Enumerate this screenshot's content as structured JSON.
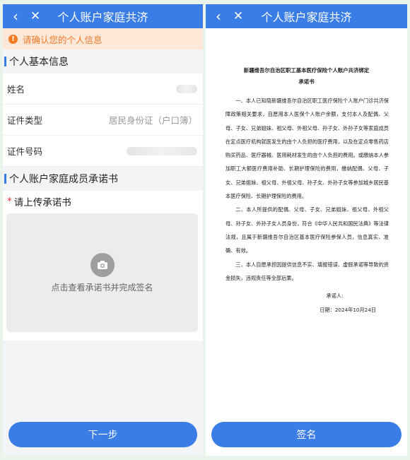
{
  "left": {
    "title": "个人账户家庭共济",
    "back_icon": "chevron-left-icon",
    "close_icon": "close-icon",
    "notice": "请确认您的个人信息",
    "basic_section": "个人基本信息",
    "rows": [
      {
        "label": "姓名",
        "value": ""
      },
      {
        "label": "证件类型",
        "value": "居民身份证（户口簿）"
      },
      {
        "label": "证件号码",
        "value": ""
      }
    ],
    "pledge_section": "个人账户家庭成员承诺书",
    "upload_required": "*",
    "upload_label": "请上传承诺书",
    "upload_hint": "点击查看承诺书并完成签名",
    "next_button": "下一步"
  },
  "right": {
    "title": "个人账户家庭共济",
    "doc_title": "新疆维吾尔自治区职工基本医疗保险个人账户共济绑定",
    "doc_sub": "承诺书",
    "paragraphs": [
      "一、本人已知晓新疆维吾尔自治区职工医疗保险个人账户门诊共济保障政策相关要求，自愿用本人医保个人账户余额，支付本人及配偶、父母、子女、兄弟姐妹、祖父母、外祖父母、孙子女、外孙子女等家庭成员在定点医疗机构就医发生的由个人负担的医疗费用，以及在定点零售药店购买药品、医疗器械、医用耗材发生的由个人负担的费用。或缴纳本人参加职工大额医疗费用补助、长期护理保险的费用，缴纳配偶、父母、子女、兄弟姐妹、祖父母、外祖父母、孙子女、外孙子女等参加城乡居民基本医疗保险、长期护理保险的费用。",
      "二、本人所提供的配偶、父母、子女、兄弟姐妹、祖父母、外祖父母、孙子女、外孙子女人员身份，符合《中华人民共和国民法典》等法律法规，且属于新疆维吾尔自治区基本医疗保险参保人员，信息真实、准确、有效。",
      "三、本人自愿承担因提供信息不实、填报错误、虚假承诺等导致的资金损失，违规责任等全部后果。"
    ],
    "signer_label": "承诺人:",
    "date_line": "日期：2024年10月24日",
    "sign_button": "签名"
  }
}
